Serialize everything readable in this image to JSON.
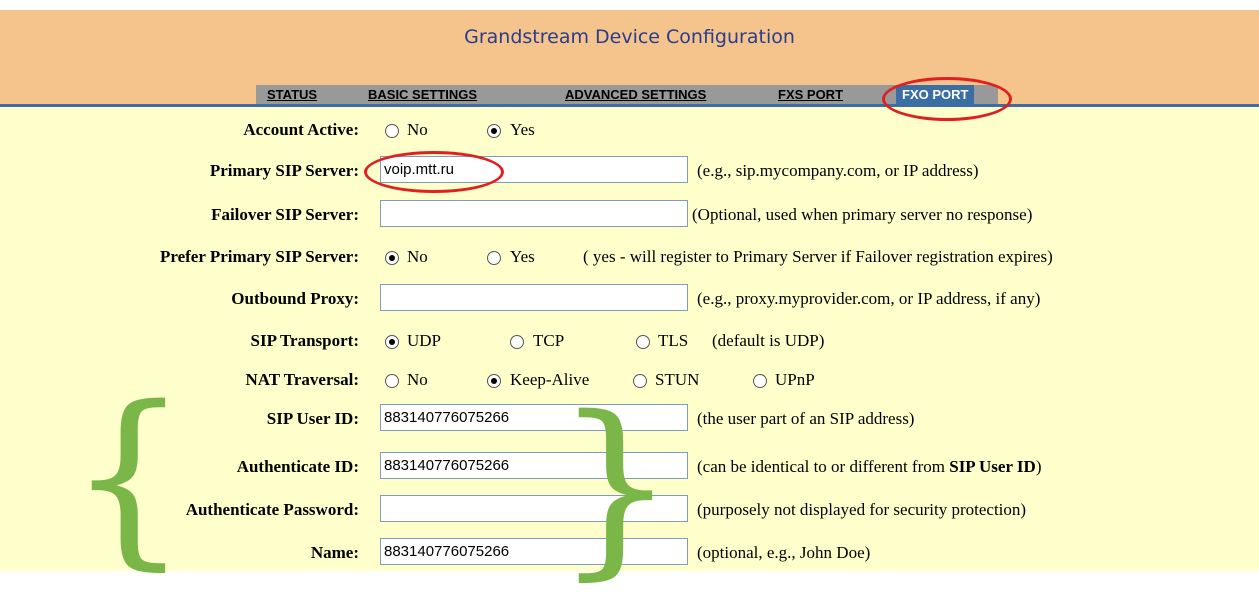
{
  "header": {
    "title": "Grandstream Device Configuration"
  },
  "tabs": [
    {
      "label": "STATUS"
    },
    {
      "label": "BASIC SETTINGS"
    },
    {
      "label": "ADVANCED SETTINGS"
    },
    {
      "label": "FXS PORT"
    },
    {
      "label": "FXO PORT",
      "active": true
    }
  ],
  "fields": {
    "account_active": {
      "label": "Account Active:",
      "options": [
        "No",
        "Yes"
      ],
      "selected": "Yes"
    },
    "primary_sip": {
      "label": "Primary SIP Server:",
      "value": "voip.mtt.ru",
      "hint": "(e.g., sip.mycompany.com, or IP address)"
    },
    "failover_sip": {
      "label": "Failover SIP Server:",
      "value": "",
      "hint": "(Optional, used when primary server no response)"
    },
    "prefer_primary": {
      "label": "Prefer Primary SIP Server:",
      "options": [
        "No",
        "Yes"
      ],
      "selected": "No",
      "hint": "( yes - will register to Primary Server if Failover registration expires)"
    },
    "outbound_proxy": {
      "label": "Outbound Proxy:",
      "value": "",
      "hint": "(e.g., proxy.myprovider.com, or IP address, if any)"
    },
    "sip_transport": {
      "label": "SIP Transport:",
      "options": [
        "UDP",
        "TCP",
        "TLS"
      ],
      "selected": "UDP",
      "hint": "(default is UDP)"
    },
    "nat_traversal": {
      "label": "NAT Traversal:",
      "options": [
        "No",
        "Keep-Alive",
        "STUN",
        "UPnP"
      ],
      "selected": "Keep-Alive"
    },
    "sip_user_id": {
      "label": "SIP User ID:",
      "value": "883140776075266",
      "hint": "(the user part of an SIP address)"
    },
    "auth_id": {
      "label": "Authenticate ID:",
      "value": "883140776075266",
      "hint_pre": "(can be identical to or different from ",
      "hint_bold": "SIP User ID",
      "hint_post": ")"
    },
    "auth_password": {
      "label": "Authenticate Password:",
      "value": "",
      "hint": "(purposely not displayed for security protection)"
    },
    "name": {
      "label": "Name:",
      "value": "883140776075266",
      "hint": "(optional, e.g., John Doe)"
    }
  },
  "annotations": {
    "accent_red": "#e02020",
    "accent_green": "#7ab648",
    "open_brace": "{",
    "close_brace": "}"
  }
}
